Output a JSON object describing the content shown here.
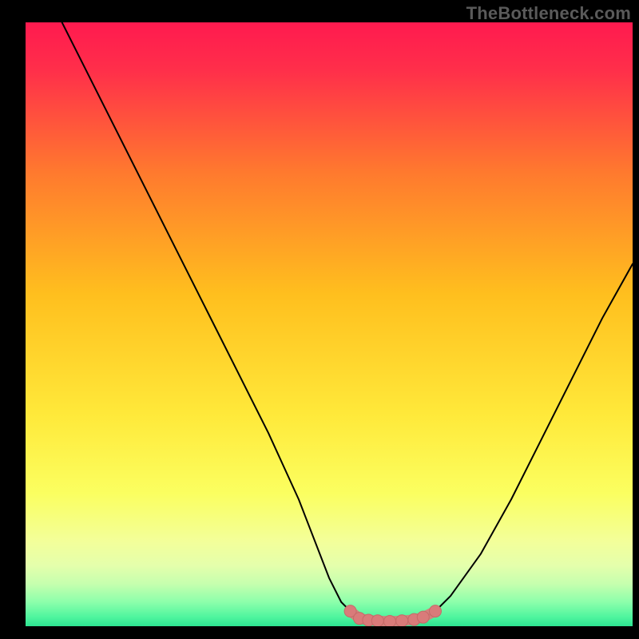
{
  "watermark": "TheBottleneck.com",
  "colors": {
    "black": "#000000",
    "grad_top": "#ff1a4f",
    "grad_mid": "#ffbf00",
    "grad_yellow": "#fff53a",
    "grad_paleyellow": "#f9ffb0",
    "grad_lightyellow": "#eaffb8",
    "grad_green1": "#c2ffb0",
    "grad_green2": "#7fffad",
    "grad_green3": "#39f39a",
    "curve_black": "#000000",
    "marker_fill": "#d97b7a",
    "marker_stroke": "#c66968"
  },
  "chart_data": {
    "type": "line",
    "title": "",
    "xlabel": "",
    "ylabel": "",
    "xlim": [
      0,
      100
    ],
    "ylim": [
      0,
      100
    ],
    "grid": false,
    "legend": false,
    "series": [
      {
        "name": "left-branch",
        "x": [
          6,
          10,
          15,
          20,
          25,
          30,
          35,
          40,
          45,
          50,
          52,
          53.5
        ],
        "y": [
          100,
          92,
          82,
          72,
          62,
          52,
          42,
          32,
          21,
          8,
          4,
          2.5
        ]
      },
      {
        "name": "bottom-flat",
        "x": [
          53.5,
          55,
          58,
          61,
          64,
          66,
          67.5
        ],
        "y": [
          2.5,
          1.2,
          0.8,
          0.8,
          1.0,
          1.6,
          2.5
        ]
      },
      {
        "name": "right-branch",
        "x": [
          67.5,
          70,
          75,
          80,
          85,
          90,
          95,
          100
        ],
        "y": [
          2.5,
          5,
          12,
          21,
          31,
          41,
          51,
          60
        ]
      }
    ],
    "markers": {
      "name": "bottom-cluster",
      "x": [
        53.5,
        55,
        56.5,
        58,
        60,
        62,
        64,
        65.5,
        67.5
      ],
      "y": [
        2.5,
        1.3,
        1.0,
        0.9,
        0.8,
        0.9,
        1.1,
        1.5,
        2.5
      ]
    }
  }
}
